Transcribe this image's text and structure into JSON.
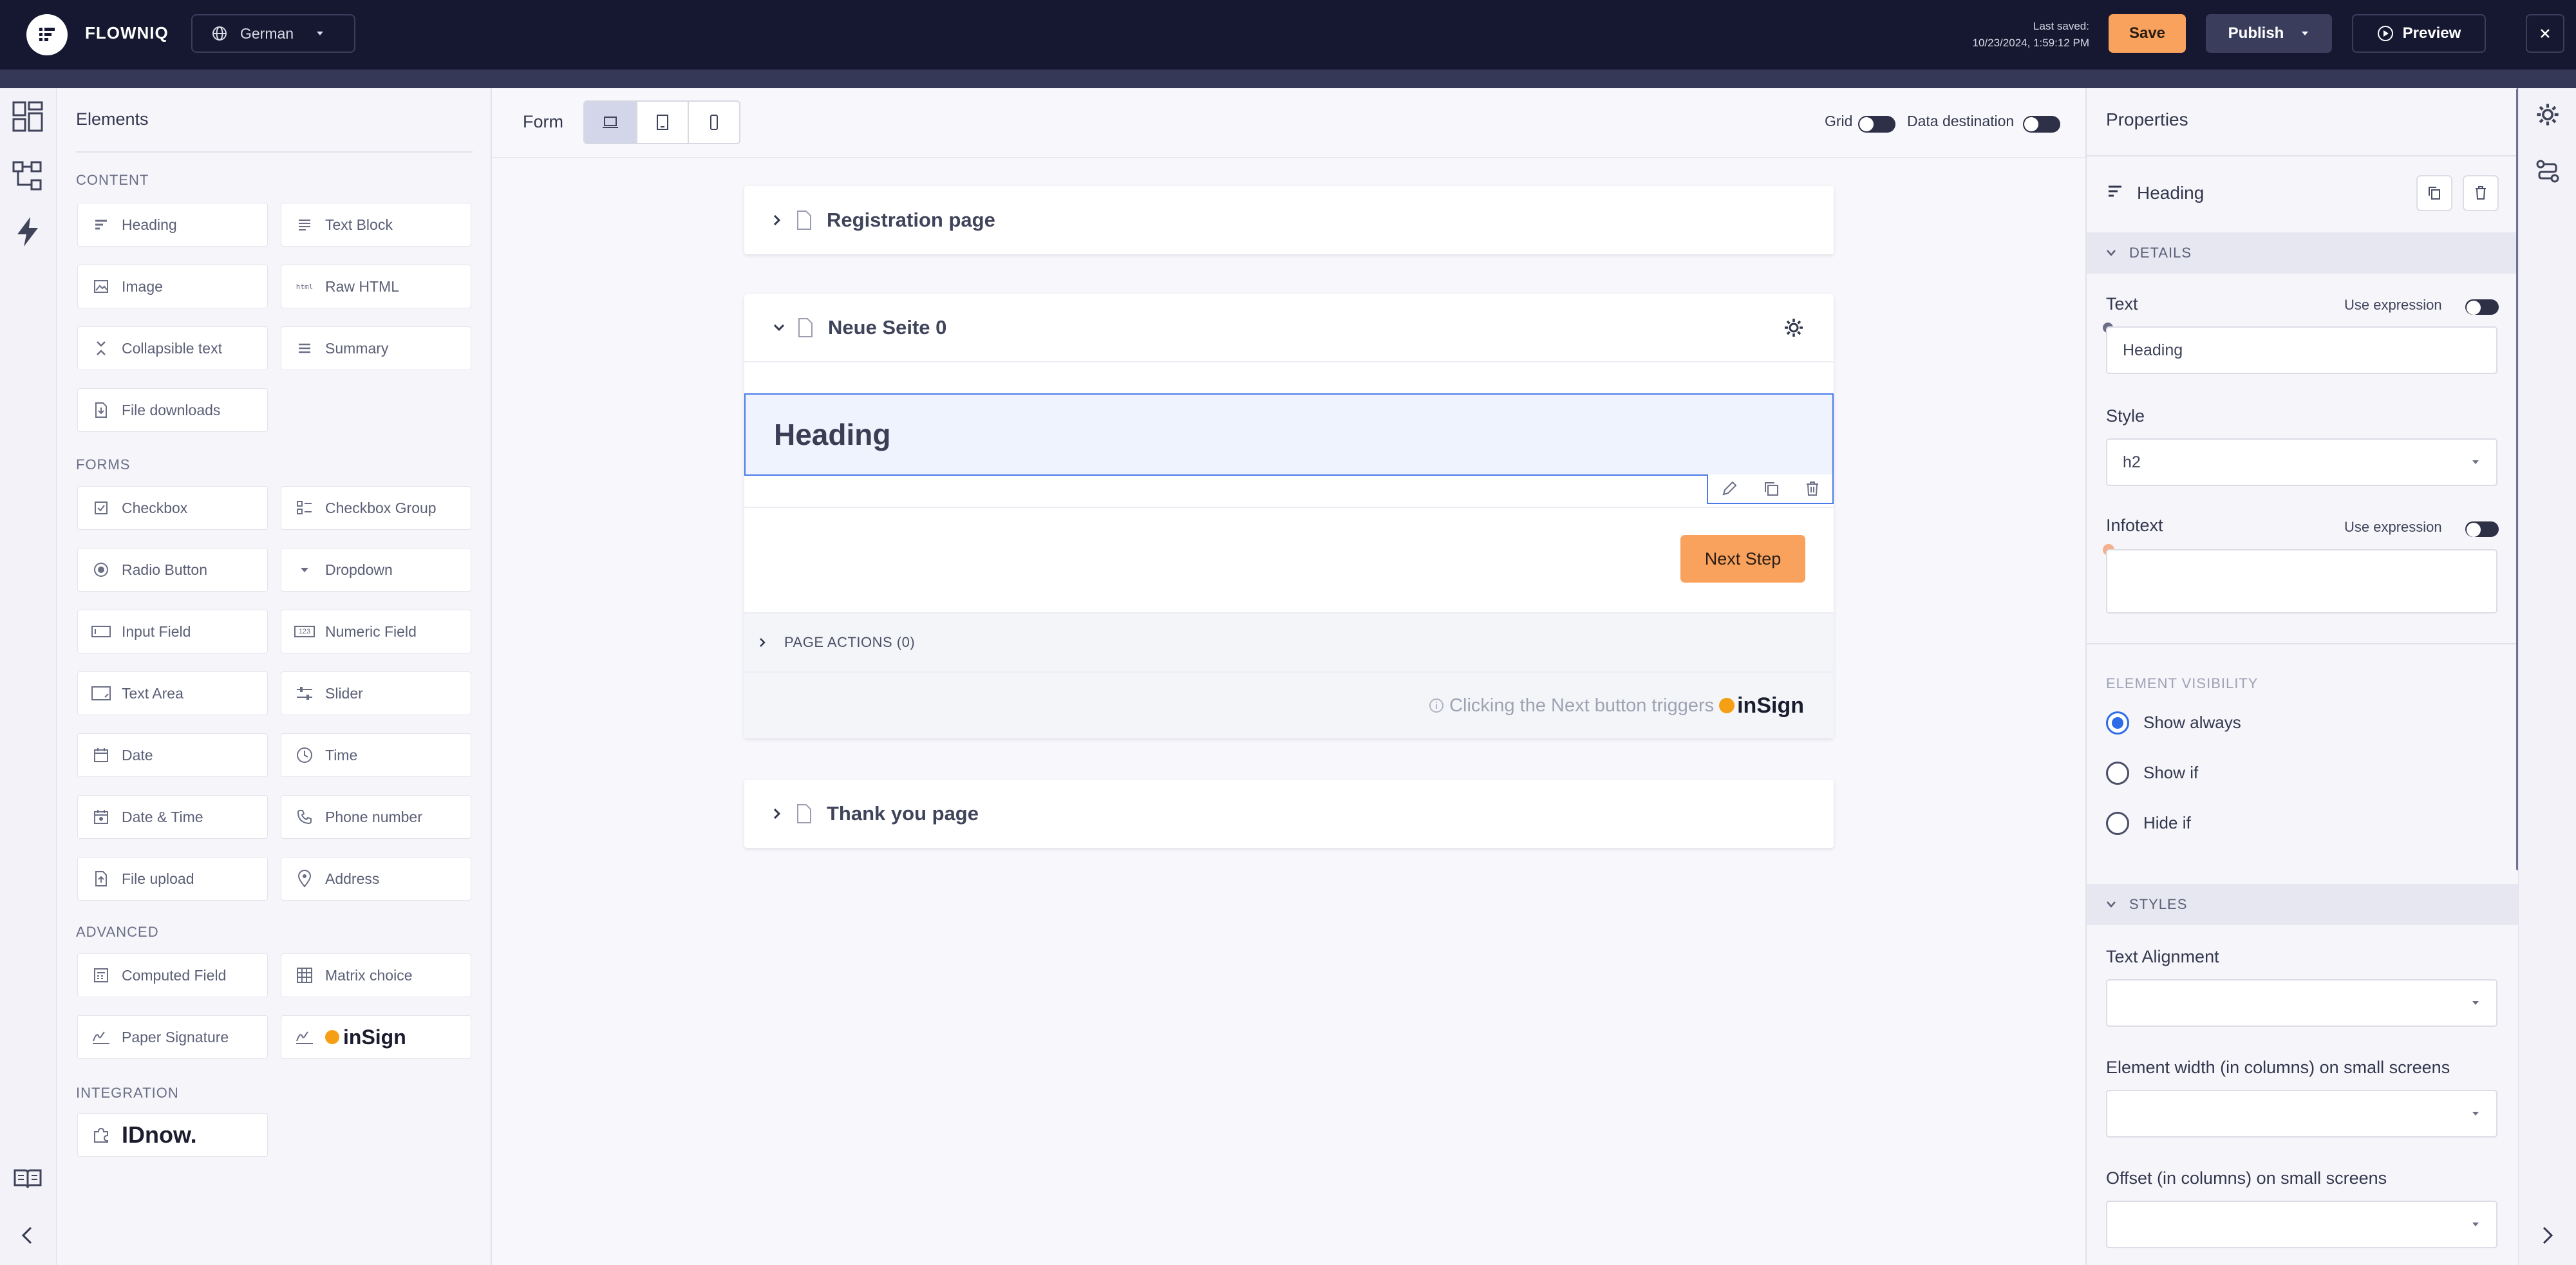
{
  "app": {
    "brand": "FLOWNIQ",
    "language": "German"
  },
  "header": {
    "last_saved_label": "Last saved:",
    "last_saved_value": "10/23/2024, 1:59:12 PM",
    "save": "Save",
    "publish": "Publish",
    "preview": "Preview"
  },
  "colors": {
    "topbar": "#151830",
    "accent_orange": "#f9a25e",
    "selected_blue": "#2e6be6",
    "publish_bg": "#3a3d5c"
  },
  "elements_panel": {
    "title": "Elements",
    "sections": {
      "content": "CONTENT",
      "forms": "FORMS",
      "advanced": "ADVANCED",
      "integration": "INTEGRATION"
    },
    "content_items": [
      "Heading",
      "Text Block",
      "Image",
      "Raw HTML",
      "Collapsible text",
      "Summary",
      "File downloads"
    ],
    "form_items": [
      "Checkbox",
      "Checkbox Group",
      "Radio Button",
      "Dropdown",
      "Input Field",
      "Numeric Field",
      "Text Area",
      "Slider",
      "Date",
      "Time",
      "Date & Time",
      "Phone number",
      "File upload",
      "Address"
    ],
    "advanced_items": [
      "Computed Field",
      "Matrix choice",
      "Paper Signature",
      "inSign"
    ],
    "integration_items": [
      "IDnow."
    ]
  },
  "canvas": {
    "form_label": "Form",
    "grid_label": "Grid",
    "data_destination_label": "Data destination",
    "pages": {
      "registration": "Registration page",
      "neue_seite": "Neue Seite 0",
      "thank_you": "Thank you page"
    },
    "heading_element_text": "Heading",
    "next_step": "Next Step",
    "page_actions": "PAGE ACTIONS (0)",
    "trigger_text": "Clicking the Next button triggers",
    "insign": "inSign"
  },
  "properties": {
    "title": "Properties",
    "element_name": "Heading",
    "details": "DETAILS",
    "text_label": "Text",
    "use_expression": "Use expression",
    "text_value": "Heading",
    "style_label": "Style",
    "style_value": "h2",
    "infotext_label": "Infotext",
    "infotext_value": "",
    "visibility_header": "ELEMENT VISIBILITY",
    "visibility_options": [
      "Show always",
      "Show if",
      "Hide if"
    ],
    "styles": "STYLES",
    "text_alignment_label": "Text Alignment",
    "width_small_label": "Element width (in columns) on small screens",
    "offset_small_label": "Offset (in columns) on small screens"
  }
}
